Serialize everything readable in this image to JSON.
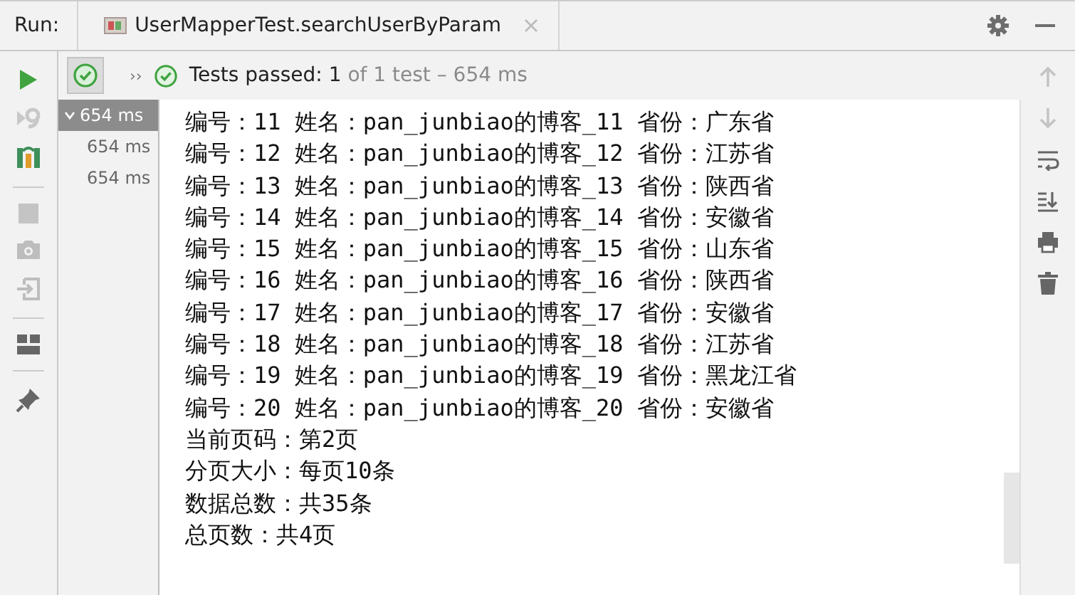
{
  "run_bar": {
    "label": "Run:",
    "tab": {
      "title": "UserMapperTest.searchUserByParam"
    }
  },
  "status": {
    "passed": "Tests passed: ",
    "count": "1",
    "detail": " of 1 test – 654 ms",
    "more": "››"
  },
  "test_tree": [
    {
      "label": "654 ms",
      "expanded": true,
      "selected": true,
      "children": [
        {
          "label": "654 ms",
          "selected": false
        },
        {
          "label": "654 ms",
          "selected": false
        }
      ]
    }
  ],
  "console": [
    "编号：11 姓名：pan_junbiao的博客_11 省份：广东省",
    "编号：12 姓名：pan_junbiao的博客_12 省份：江苏省",
    "编号：13 姓名：pan_junbiao的博客_13 省份：陕西省",
    "编号：14 姓名：pan_junbiao的博客_14 省份：安徽省",
    "编号：15 姓名：pan_junbiao的博客_15 省份：山东省",
    "编号：16 姓名：pan_junbiao的博客_16 省份：陕西省",
    "编号：17 姓名：pan_junbiao的博客_17 省份：安徽省",
    "编号：18 姓名：pan_junbiao的博客_18 省份：江苏省",
    "编号：19 姓名：pan_junbiao的博客_19 省份：黑龙江省",
    "编号：20 姓名：pan_junbiao的博客_20 省份：安徽省",
    "当前页码：第2页",
    "分页大小：每页10条",
    "数据总数：共35条",
    "总页数：共4页"
  ]
}
